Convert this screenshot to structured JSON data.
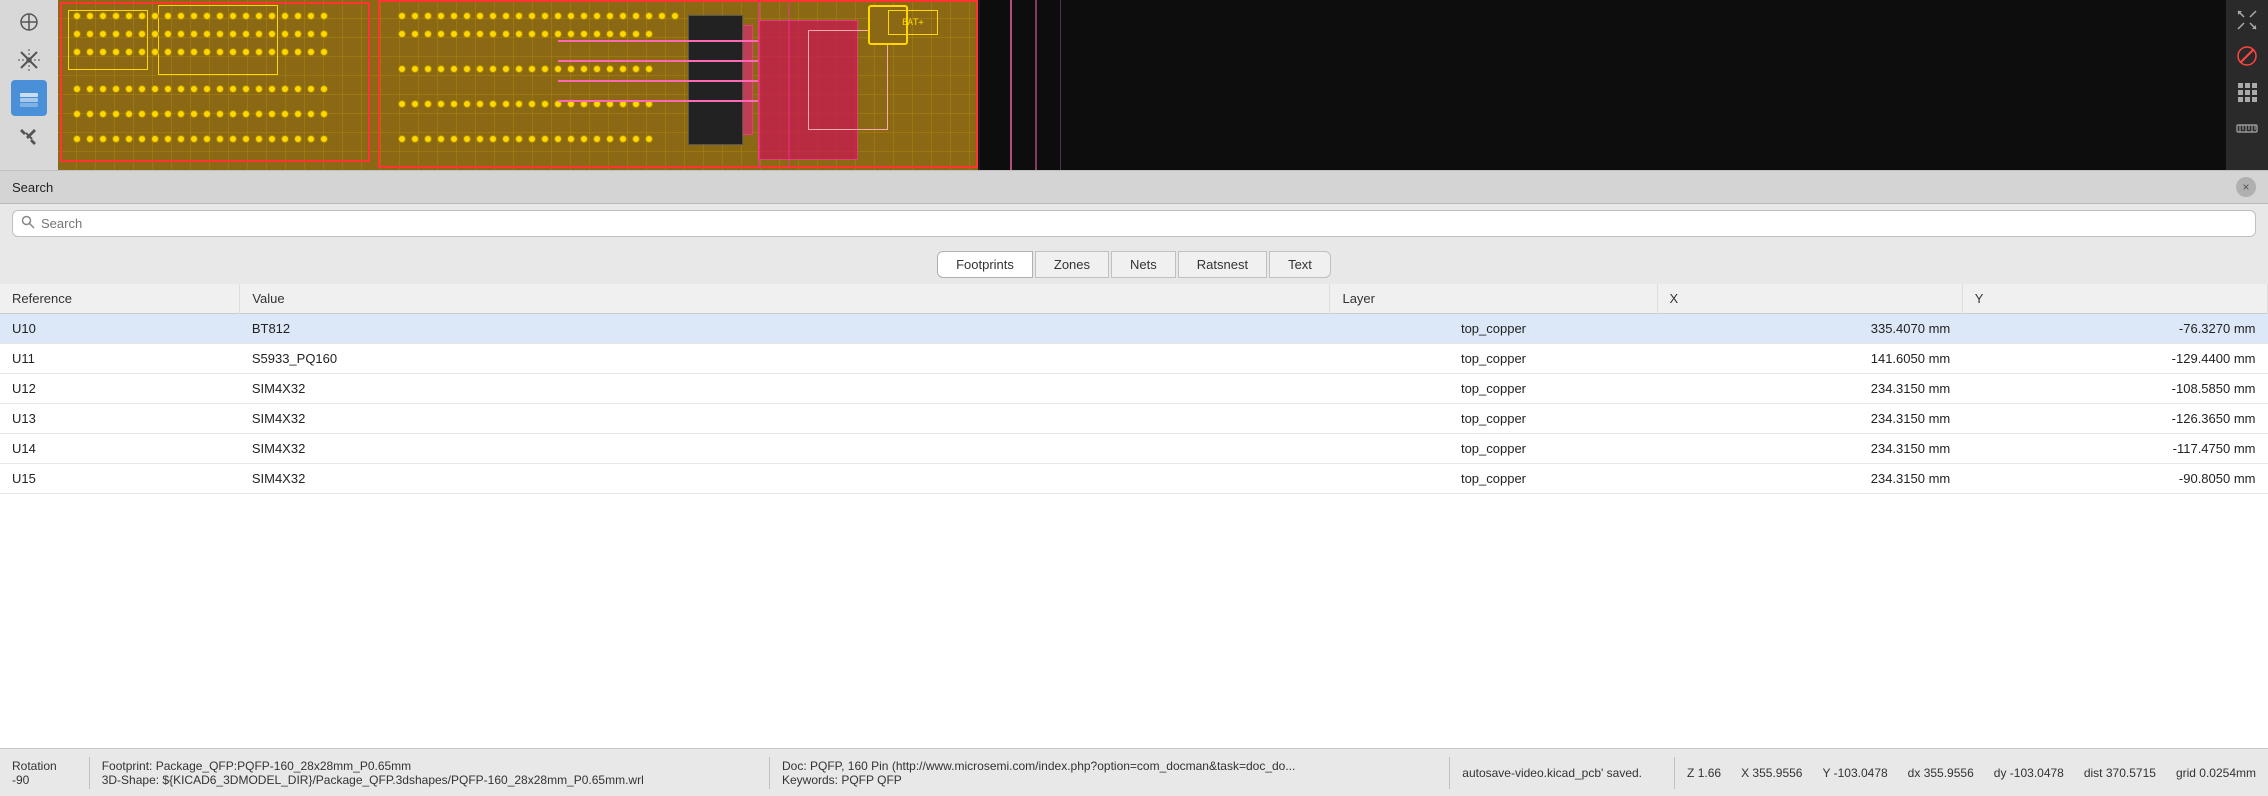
{
  "toolbar": {
    "left_buttons": [
      {
        "icon": "◎",
        "label": "cursor-icon",
        "active": false
      },
      {
        "icon": "✕",
        "label": "cross-icon",
        "active": false
      },
      {
        "icon": "⬡",
        "label": "layers-icon",
        "active": true
      },
      {
        "icon": "✦",
        "label": "tools-icon",
        "active": false
      }
    ],
    "right_buttons": [
      {
        "icon": "↖↗",
        "label": "arrows-icon"
      },
      {
        "icon": "⊘",
        "label": "cancel-icon",
        "danger": true
      },
      {
        "icon": "⊞",
        "label": "grid-icon"
      },
      {
        "icon": "📏",
        "label": "ruler-icon"
      }
    ]
  },
  "search": {
    "title": "Search",
    "placeholder": "Search",
    "close_label": "×"
  },
  "tabs": [
    {
      "label": "Footprints",
      "active": true
    },
    {
      "label": "Zones",
      "active": false
    },
    {
      "label": "Nets",
      "active": false
    },
    {
      "label": "Ratsnest",
      "active": false
    },
    {
      "label": "Text",
      "active": false
    }
  ],
  "table": {
    "headers": [
      {
        "label": "Reference",
        "key": "ref"
      },
      {
        "label": "Value",
        "key": "val"
      },
      {
        "label": "Layer",
        "key": "layer"
      },
      {
        "label": "X",
        "key": "x"
      },
      {
        "label": "Y",
        "key": "y"
      }
    ],
    "rows": [
      {
        "ref": "U10",
        "val": "BT812",
        "layer": "top_copper",
        "x": "335.4070 mm",
        "y": "-76.3270 mm",
        "selected": true
      },
      {
        "ref": "U11",
        "val": "S5933_PQ160",
        "layer": "top_copper",
        "x": "141.6050 mm",
        "y": "-129.4400 mm",
        "selected": false
      },
      {
        "ref": "U12",
        "val": "SIM4X32",
        "layer": "top_copper",
        "x": "234.3150 mm",
        "y": "-108.5850 mm",
        "selected": false
      },
      {
        "ref": "U13",
        "val": "SIM4X32",
        "layer": "top_copper",
        "x": "234.3150 mm",
        "y": "-126.3650 mm",
        "selected": false
      },
      {
        "ref": "U14",
        "val": "SIM4X32",
        "layer": "top_copper",
        "x": "234.3150 mm",
        "y": "-117.4750 mm",
        "selected": false
      },
      {
        "ref": "U15",
        "val": "SIM4X32",
        "layer": "top_copper",
        "x": "234.3150 mm",
        "y": "-90.8050 mm",
        "selected": false
      }
    ]
  },
  "status_bar": {
    "rotation_label": "Rotation",
    "rotation_value": "-90",
    "footprint_label": "Footprint: Package_QFP:PQFP-160_28x28mm_P0.65mm",
    "shape_label": "3D-Shape: ${KICAD6_3DMODEL_DIR}/Package_QFP.3dshapes/PQFP-160_28x28mm_P0.65mm.wrl",
    "doc_label": "Doc: PQFP, 160 Pin (http://www.microsemi.com/index.php?option=com_docman&task=doc_do...",
    "keywords_label": "Keywords: PQFP QFP",
    "saved_msg": "autosave-video.kicad_pcb' saved.",
    "z_label": "Z",
    "z_value": "1.66",
    "x_label": "X",
    "x_value": "355.9556",
    "y_label": "Y",
    "y_value": "-103.0478",
    "dx_label": "dx",
    "dx_value": "355.9556",
    "dy_label": "dy",
    "dy_value": "-103.0478",
    "dist_label": "dist",
    "dist_value": "370.5715",
    "grid_label": "grid",
    "grid_value": "0.0254",
    "unit": "mm"
  }
}
